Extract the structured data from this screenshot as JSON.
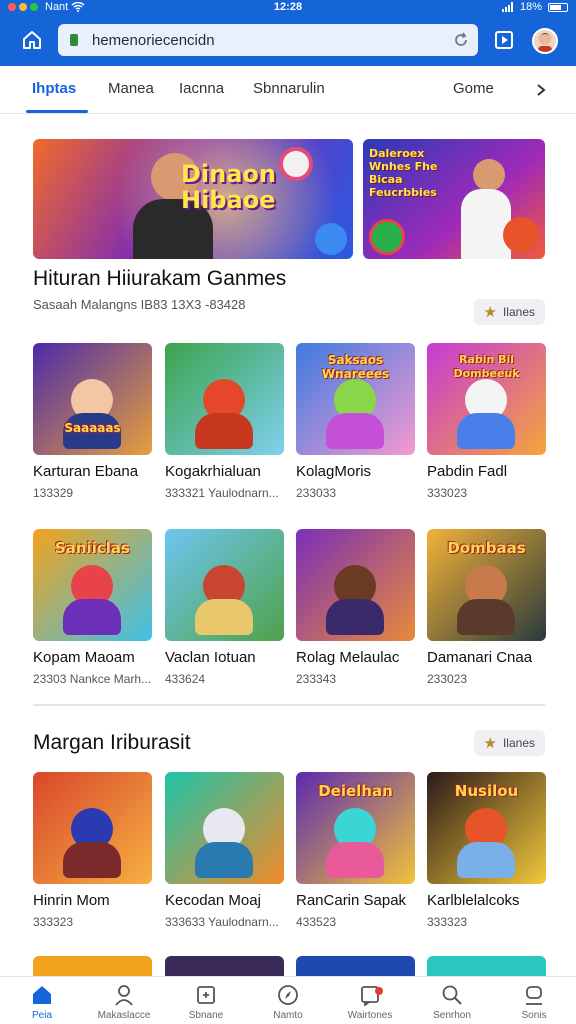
{
  "status": {
    "carrier": "Nant",
    "time": "12:28",
    "battery": "18%"
  },
  "toolbar": {
    "url": "hemenoriecencidn"
  },
  "tabs": [
    {
      "label": "Ihptas",
      "active": true
    },
    {
      "label": "Manea",
      "active": false
    },
    {
      "label": "Iacnna",
      "active": false
    },
    {
      "label": "Sbnnarulin",
      "active": false
    },
    {
      "label": "Gome",
      "active": false
    }
  ],
  "heroes": [
    {
      "text": "Dinaon Hibaoe"
    },
    {
      "text": "Daleroex Wnhes Fhe Bicaa Feucrbbies"
    }
  ],
  "section1": {
    "title": "Hituran Hiiurakam Ganmes",
    "subtitle": "Sasaah Malangns IB83 13X3 -83428",
    "more_label": "Ilanes",
    "rows": [
      [
        {
          "name": "Karturan Ebana",
          "meta": "133329",
          "art": "Saaaaas",
          "colors": [
            "#4b2aa8",
            "#e7a03c",
            "#f2c7a5",
            "#2a3a8a"
          ]
        },
        {
          "name": "Kogakrhialuan",
          "meta": "333321 Yaulodnarn...",
          "art": "",
          "colors": [
            "#3aa34b",
            "#7fd0f0",
            "#e5472b",
            "#c7391e"
          ]
        },
        {
          "name": "KolagMoris",
          "meta": "233033",
          "art": "Saksaos Wnareees",
          "colors": [
            "#3d7be0",
            "#f59ad1",
            "#8ad64a",
            "#c350d6"
          ]
        },
        {
          "name": "Pabdin Fadl",
          "meta": "333023",
          "art": "Rabin Bil Dombeeuk",
          "colors": [
            "#c53ad6",
            "#f6a53b",
            "#f4f4f4",
            "#4a7ee8"
          ]
        }
      ],
      [
        {
          "name": "Kopam Maoam",
          "meta": "23303 Nankce Marh...",
          "art": "Saniiclas",
          "colors": [
            "#f2a21d",
            "#3ec1e8",
            "#e8424a",
            "#6b2fb8"
          ]
        },
        {
          "name": "Vaclan Iotuan",
          "meta": "433624",
          "art": "",
          "colors": [
            "#6ec6f0",
            "#4fa24a",
            "#c8452f",
            "#e8c86a"
          ]
        },
        {
          "name": "Rolag Melaulac",
          "meta": "233343",
          "art": "",
          "colors": [
            "#7b2fb8",
            "#e88a3a",
            "#6b3a22",
            "#3a2a6a"
          ]
        },
        {
          "name": "Damanari Cnaa",
          "meta": "233023",
          "art": "Dombaas",
          "colors": [
            "#f2b23a",
            "#2a3a3a",
            "#c97a4a",
            "#5a3a2a"
          ]
        }
      ]
    ]
  },
  "section2": {
    "title": "Margan Iriburasit",
    "more_label": "Ilanes",
    "cards": [
      {
        "name": "Hinrin Mom",
        "meta": "333323",
        "art": "",
        "colors": [
          "#d8472b",
          "#f6b042",
          "#2a3ab0",
          "#7a2a2a"
        ]
      },
      {
        "name": "Kecodan Moaj",
        "meta": "333633 Yaulodnarn...",
        "art": "",
        "colors": [
          "#1ec4a8",
          "#f28a2a",
          "#e8e8f0",
          "#2a7ab0"
        ]
      },
      {
        "name": "RanCarin Sapak",
        "meta": "433523",
        "art": "Deielhan",
        "colors": [
          "#5a2ab0",
          "#f2c23a",
          "#3ad6d6",
          "#e85a9a"
        ]
      },
      {
        "name": "Karlblelalcoks",
        "meta": "333323",
        "art": "Nusilou",
        "colors": [
          "#2a1a1a",
          "#f2c83a",
          "#e8542a",
          "#7ab0e8"
        ]
      }
    ]
  },
  "partial_colors": [
    "#f2a21d",
    "#3a2a5a",
    "#1e4ab0",
    "#2ac6c0"
  ],
  "bottom_nav": [
    {
      "label": "Peia",
      "icon": "home-icon",
      "active": true
    },
    {
      "label": "Makaslacce",
      "icon": "user-icon",
      "active": false
    },
    {
      "label": "Sbnane",
      "icon": "puzzle-icon",
      "active": false
    },
    {
      "label": "Namto",
      "icon": "compass-icon",
      "active": false
    },
    {
      "label": "Wairtones",
      "icon": "notifications-icon",
      "active": false
    },
    {
      "label": "Senrhon",
      "icon": "search-icon",
      "active": false
    },
    {
      "label": "Sonis",
      "icon": "account-icon",
      "active": false
    }
  ],
  "colors": {
    "accent": "#1565d8",
    "background": "#ffffff"
  }
}
